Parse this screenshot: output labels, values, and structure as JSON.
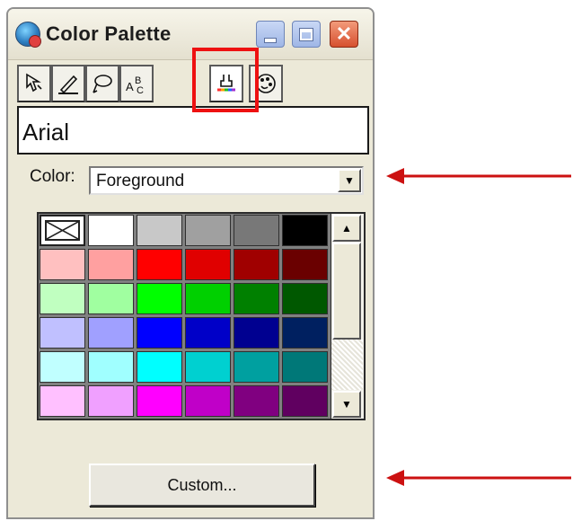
{
  "window": {
    "title": "Color Palette",
    "icon": "color-palette-app-icon",
    "controls": [
      "minimize-icon",
      "maximize-icon",
      "close-icon"
    ]
  },
  "tool_tabs": [
    {
      "name": "fill-bucket-icon",
      "active": false
    },
    {
      "name": "pencil-line-icon",
      "active": false
    },
    {
      "name": "lasso-brush-icon",
      "active": false
    },
    {
      "name": "text-abc-icon",
      "active": false
    },
    {
      "name": "font-color-icon",
      "active": true
    },
    {
      "name": "palette-icon",
      "active": false
    }
  ],
  "font_display": {
    "value": "Arial"
  },
  "color_select": {
    "label": "Color:",
    "value": "Foreground"
  },
  "swatches": {
    "rows": [
      [
        "none",
        "#ffffff",
        "#c8c8c8",
        "#a0a0a0",
        "#787878",
        "#000000"
      ],
      [
        "#ffc0c0",
        "#ffa0a0",
        "#ff0000",
        "#e00000",
        "#a00000",
        "#6a0000"
      ],
      [
        "#c0ffc0",
        "#a0ffa0",
        "#00ff00",
        "#00d000",
        "#008000",
        "#005800"
      ],
      [
        "#c0c0ff",
        "#a0a0ff",
        "#0000ff",
        "#0000c8",
        "#000090",
        "#002060"
      ],
      [
        "#c0ffff",
        "#a0ffff",
        "#00ffff",
        "#00d0d0",
        "#00a0a0",
        "#007878"
      ],
      [
        "#ffc0ff",
        "#f0a0ff",
        "#ff00ff",
        "#c000c8",
        "#800080",
        "#600060"
      ]
    ]
  },
  "custom_button": {
    "label": "Custom..."
  },
  "annotations": {
    "highlight_color": "#ee1111",
    "arrow_color": "#cc1111"
  }
}
